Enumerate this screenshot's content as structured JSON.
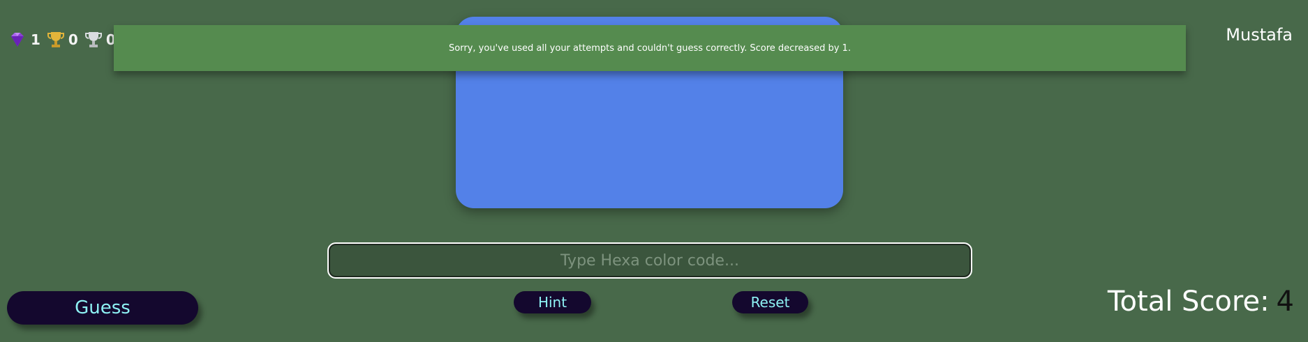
{
  "badges": [
    {
      "icon": "diamond-icon",
      "count": "1"
    },
    {
      "icon": "gold-trophy-icon",
      "count": "0"
    },
    {
      "icon": "silver-trophy-icon",
      "count": "0"
    }
  ],
  "user": {
    "name": "Mustafa"
  },
  "notification": {
    "message": "Sorry, you've used all your attempts and couldn't guess correctly. Score decreased by 1.",
    "background_color": "#558b4f"
  },
  "swatch": {
    "color": "#5381e8"
  },
  "input": {
    "placeholder": "Type Hexa color code...",
    "value": ""
  },
  "buttons": {
    "guess": "Guess",
    "hint": "Hint",
    "reset": "Reset"
  },
  "score": {
    "label": "Total Score:",
    "value": "4"
  },
  "colors": {
    "background": "#48694a",
    "button_bg": "#14082e",
    "button_text": "#8ef2f4"
  }
}
